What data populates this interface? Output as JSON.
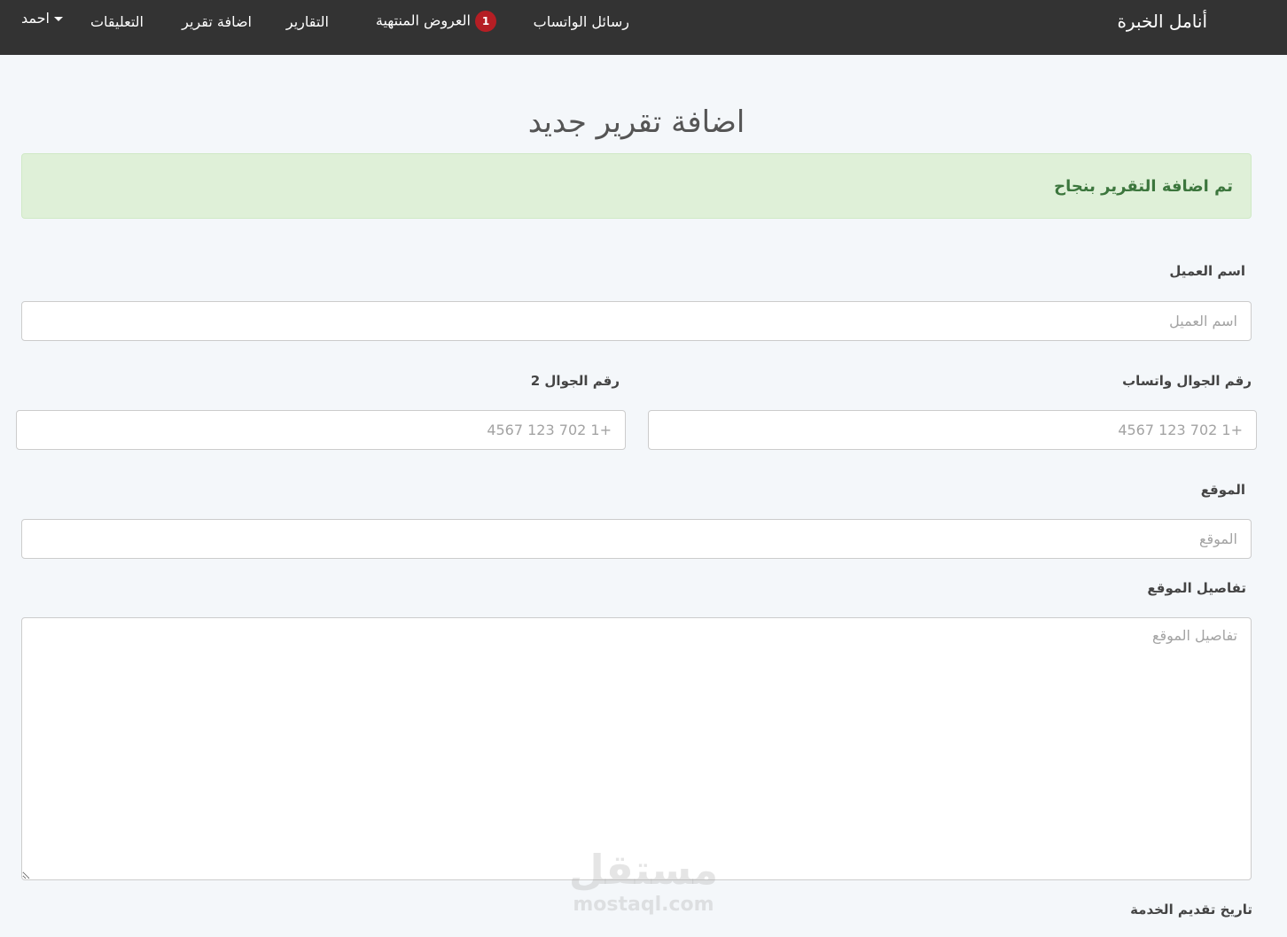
{
  "navbar": {
    "brand": "أنامل الخبرة",
    "items": [
      {
        "label": "رسائل الواتساب"
      },
      {
        "label": "العروض المنتهية",
        "badge": "1"
      },
      {
        "label": "التقارير"
      },
      {
        "label": "اضافة تقرير"
      },
      {
        "label": "التعليقات"
      }
    ],
    "user": {
      "name": "احمد"
    }
  },
  "page": {
    "title": "اضافة تقرير جديد"
  },
  "alert": {
    "message": "تم اضافة التقرير بنجاح",
    "type": "success"
  },
  "form": {
    "client_name": {
      "label": "اسم العميل",
      "placeholder": "اسم العميل",
      "value": ""
    },
    "phone_whatsapp": {
      "label": "رقم الجوال واتساب",
      "placeholder": "+1 702 123 4567",
      "value": ""
    },
    "phone_2": {
      "label": "رقم الجوال 2",
      "placeholder": "+1 702 123 4567",
      "value": ""
    },
    "location": {
      "label": "الموقع",
      "placeholder": "الموقع",
      "value": ""
    },
    "location_details": {
      "label": "تفاصيل الموقع",
      "placeholder": "تفاصيل الموقع",
      "value": ""
    },
    "service_date": {
      "label": "تاريخ تقديم الخدمة"
    }
  },
  "watermark": {
    "arabic": "مستقل",
    "latin": "mostaql.com"
  },
  "colors": {
    "navbar_bg": "#333333",
    "page_bg": "#f4f7fa",
    "badge": "#b51e24",
    "alert_bg": "#dff0d8",
    "alert_text": "#3c763d"
  }
}
